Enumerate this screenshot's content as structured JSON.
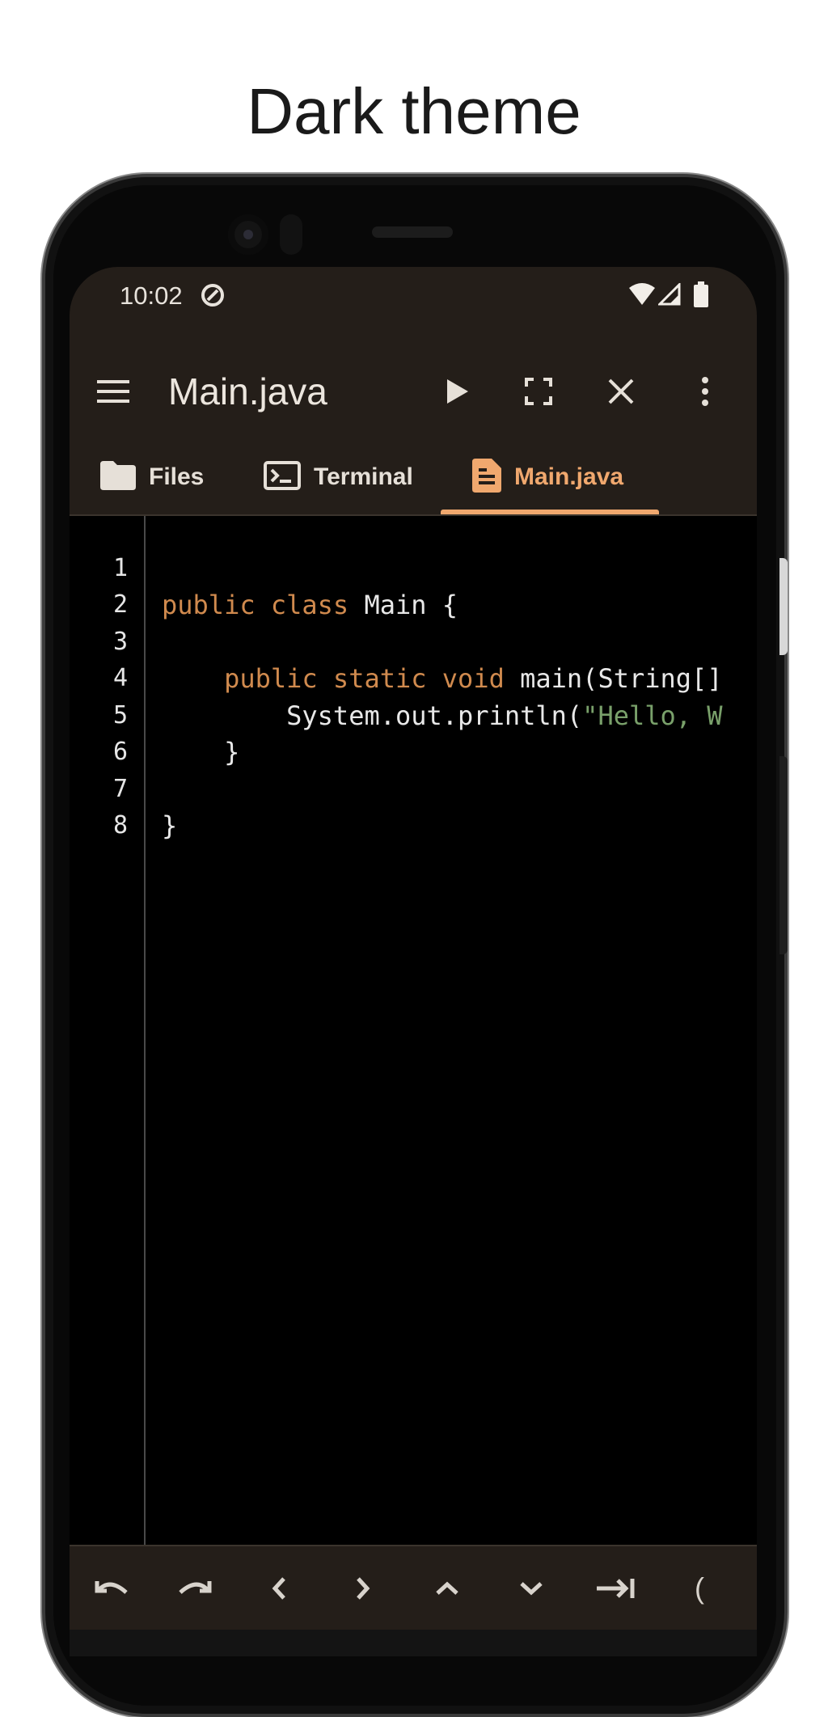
{
  "headline": "Dark theme",
  "status": {
    "time": "10:02"
  },
  "toolbar": {
    "title": "Main.java",
    "icons": [
      "menu-icon",
      "play-icon",
      "fullscreen-icon",
      "close-icon",
      "more-vert-icon"
    ]
  },
  "tabs": [
    {
      "label": "Files",
      "icon": "folder-icon",
      "active": false
    },
    {
      "label": "Terminal",
      "icon": "terminal-icon",
      "active": false
    },
    {
      "label": "Main.java",
      "icon": "document-icon",
      "active": true
    }
  ],
  "editor": {
    "line_numbers": [
      "1",
      "2",
      "3",
      "4",
      "5",
      "6",
      "7",
      "8"
    ],
    "lines": {
      "l2_kw": "public class",
      "l2_rest": " Main {",
      "l4_indent": "    ",
      "l4_kw": "public static void",
      "l4_rest": " main(String[]",
      "l5_indent": "        ",
      "l5_rest": "System.out.println(",
      "l5_str": "\"Hello, W",
      "l6": "    }",
      "l8": "}"
    }
  },
  "keybar": {
    "keys": [
      "undo-icon",
      "redo-icon",
      "left-icon",
      "right-icon",
      "up-icon",
      "down-icon",
      "tab-icon"
    ],
    "paren": "("
  },
  "colors": {
    "accent": "#f0a86e",
    "keyword": "#d08a4e",
    "string": "#79a06a",
    "appbar": "#241e19"
  }
}
